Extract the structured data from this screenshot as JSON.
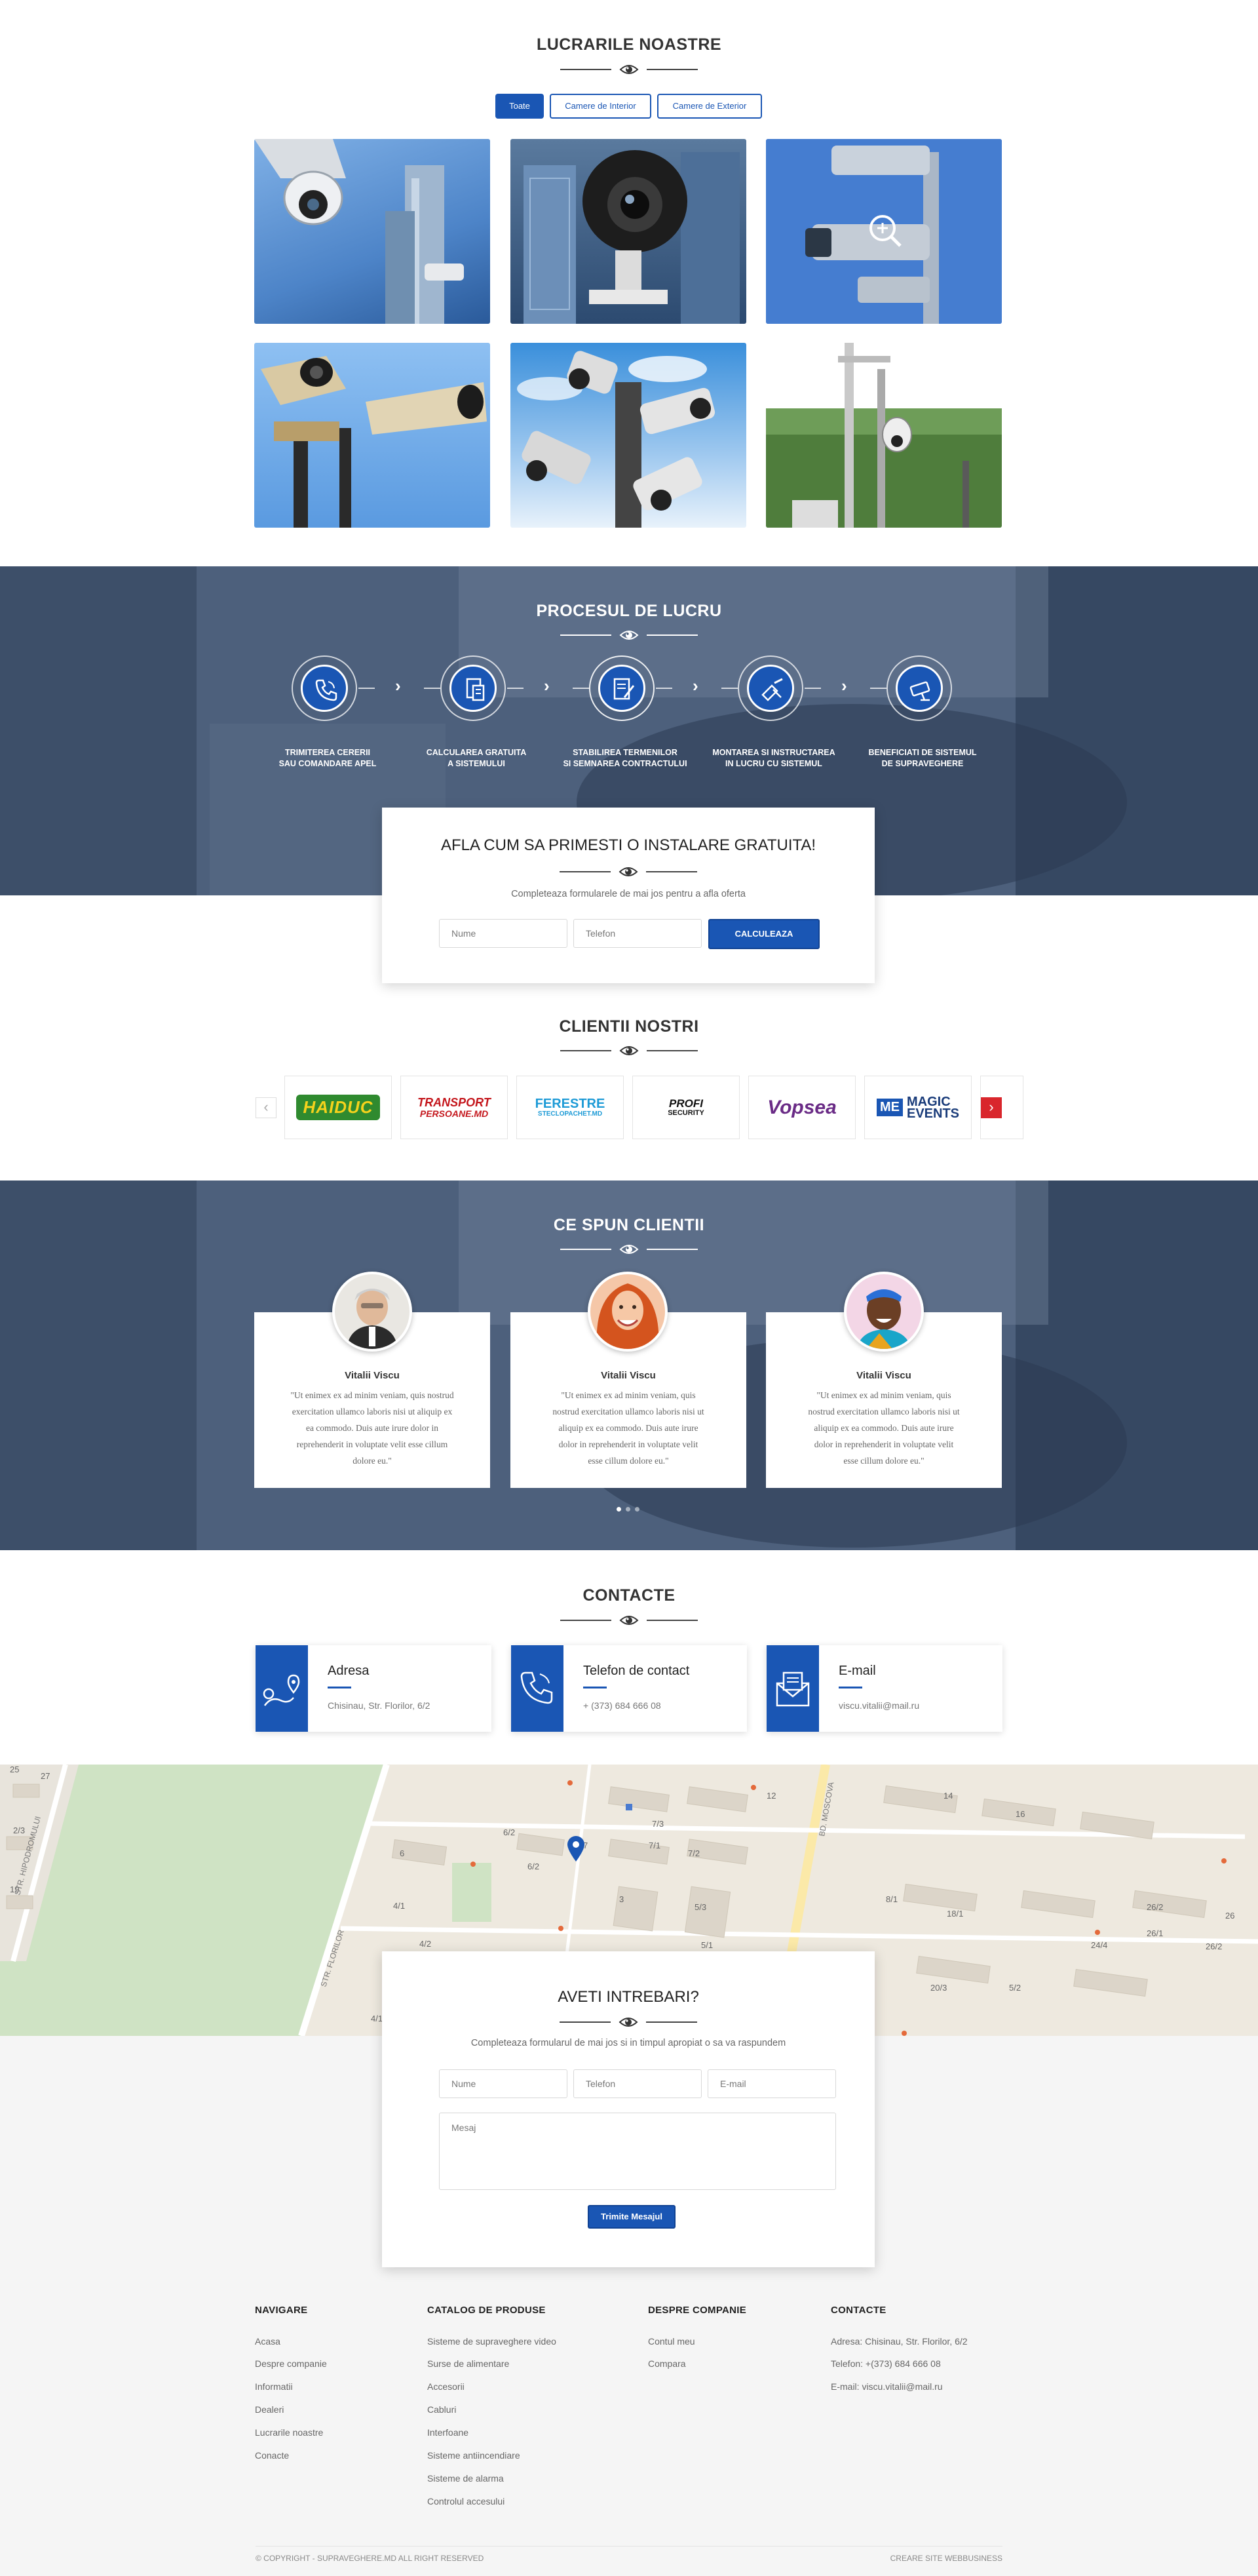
{
  "works": {
    "title": "LUCRARILE NOASTRE",
    "filters": [
      "Toate",
      "Camere de Interior",
      "Camere de Exterior"
    ]
  },
  "process": {
    "title": "PROCESUL DE LUCRU",
    "steps": [
      [
        "TRIMITEREA CERERII",
        "SAU COMANDARE APEL"
      ],
      [
        "CALCULAREA GRATUITA",
        "A SISTEMULUI"
      ],
      [
        "STABILIREA TERMENILOR",
        "SI SEMNAREA CONTRACTULUI"
      ],
      [
        "MONTAREA SI INSTRUCTAREA",
        "IN LUCRU CU SISTEMUL"
      ],
      [
        "BENEFICIATI DE SISTEMUL",
        "DE SUPRAVEGHERE"
      ]
    ]
  },
  "offer": {
    "title": "AFLA CUM SA PRIMESTI O INSTALARE GRATUITA!",
    "subtitle": "Completeaza formularele de mai jos pentru a afla oferta",
    "name_placeholder": "Nume",
    "phone_placeholder": "Telefon",
    "button": "CALCULEAZA"
  },
  "clients": {
    "title": "CLIENTII NOSTRI",
    "logos": [
      {
        "name": "HAIDUC",
        "sub": ""
      },
      {
        "name": "TRANSPORT",
        "sub": "PERSOANE.MD"
      },
      {
        "name": "FERESTRE",
        "sub": "STECLOPACHET.MD"
      },
      {
        "name": "PROFI",
        "sub": "SECURITY"
      },
      {
        "name": "Vopsea",
        "sub": ""
      },
      {
        "name": "MAGIC",
        "sub": "EVENTS"
      }
    ]
  },
  "testimonials": {
    "title": "CE SPUN CLIENTII",
    "items": [
      {
        "name": "Vitalii Viscu",
        "lines": [
          "\"Ut enimex ex ad minim veniam, quis nostrud",
          "exercitation ullamco laboris nisi ut aliquip ex",
          "ea commodo. Duis aute irure dolor in",
          "reprehenderit in voluptate velit esse cillum",
          "dolore eu.\""
        ]
      },
      {
        "name": "Vitalii Viscu",
        "lines": [
          "\"Ut enimex ex ad minim veniam, quis",
          "nostrud exercitation ullamco laboris nisi ut",
          "aliquip ex ea commodo. Duis aute irure",
          "dolor in reprehenderit in voluptate velit",
          "esse cillum dolore eu.\""
        ]
      },
      {
        "name": "Vitalii Viscu",
        "lines": [
          "\"Ut enimex ex ad minim veniam, quis",
          "nostrud exercitation ullamco laboris nisi ut",
          "aliquip ex ea commodo. Duis aute irure",
          "dolor in reprehenderit in voluptate velit",
          "esse cillum dolore eu.\""
        ]
      }
    ]
  },
  "contacts": {
    "title": "CONTACTE",
    "cards": [
      {
        "title": "Adresa",
        "value": "Chisinau, Str. Florilor, 6/2",
        "icon": "map-pin-icon"
      },
      {
        "title": "Telefon de contact",
        "value": "+ (373) 684 666 08",
        "icon": "phone-icon"
      },
      {
        "title": "E-mail",
        "value": "viscu.vitalii@mail.ru",
        "icon": "envelope-icon"
      }
    ]
  },
  "map": {
    "streets": [
      "STR. HIPODROMULUI",
      "STR. FLORILOR",
      "BD. MOSCOVA"
    ],
    "numbers": [
      "25",
      "27",
      "2/3",
      "19",
      "6/2",
      "6/2",
      "7/3",
      "7/1",
      "7/2",
      "12",
      "14",
      "16",
      "7",
      "3",
      "6",
      "4/1",
      "4/2",
      "5/3",
      "5/1",
      "8/1",
      "18/1",
      "26/2",
      "26/1",
      "24/4",
      "26/2",
      "26",
      "20/3",
      "4/1",
      "5/2"
    ]
  },
  "question_form": {
    "title": "AVETI INTREBARI?",
    "subtitle": "Completeaza formularul de mai jos si in timpul apropiat o sa va raspundem",
    "name_placeholder": "Nume",
    "phone_placeholder": "Telefon",
    "email_placeholder": "E-mail",
    "message_placeholder": "Mesaj",
    "button": "Trimite Mesajul"
  },
  "footer": {
    "columns": [
      {
        "title": "NAVIGARE",
        "links": [
          "Acasa",
          "Despre companie",
          "Informatii",
          "Dealeri",
          "Lucrarile noastre",
          "Conacte"
        ]
      },
      {
        "title": "CATALOG DE PRODUSE",
        "links": [
          "Sisteme de supraveghere video",
          "Surse de alimentare",
          "Accesorii",
          "Cabluri",
          "Interfoane",
          "Sisteme antiincendiare",
          "Sisteme de alarma",
          "Controlul accesului"
        ]
      },
      {
        "title": "DESPRE COMPANIE",
        "links": [
          "Contul meu",
          "Compara"
        ]
      },
      {
        "title": "CONTACTE",
        "links": [
          "Adresa: Chisinau, Str. Florilor, 6/2",
          "Telefon: +(373) 684 666 08",
          "E-mail: viscu.vitalii@mail.ru"
        ]
      }
    ],
    "copyright": "© COPYRIGHT - SUPRAVEGHERE.MD ALL RIGHT RESERVED",
    "credit": "CREARE SITE WEBBUSINESS"
  },
  "colors": {
    "accent": "#1a56b4",
    "band": "#3a4e6b",
    "footer_bg": "#f5f5f5",
    "arrow_red": "#d9262c"
  }
}
